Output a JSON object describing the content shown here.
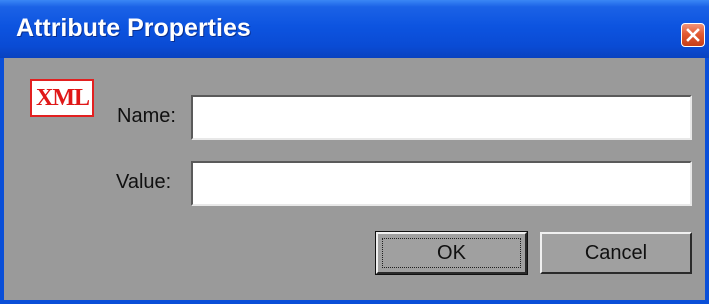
{
  "window": {
    "title": "Attribute Properties"
  },
  "icons": {
    "app_icon": "xml-icon",
    "app_icon_text": "XML",
    "close_icon": "close-icon"
  },
  "form": {
    "name_label": "Name:",
    "name_value": "",
    "value_label": "Value:",
    "value_value": ""
  },
  "buttons": {
    "ok_label": "OK",
    "cancel_label": "Cancel"
  },
  "colors": {
    "title_bar": "#0a4bd4",
    "client_background": "#9a9a9a",
    "close_button": "#e35b33",
    "xml_icon": "#e01818"
  }
}
